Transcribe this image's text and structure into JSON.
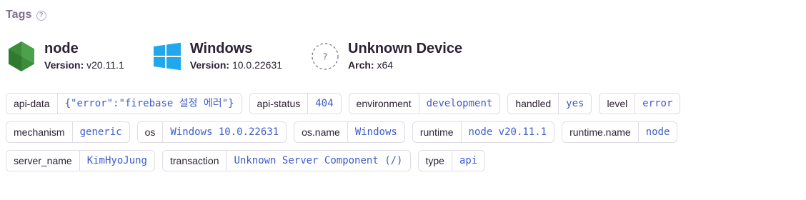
{
  "header": {
    "title": "Tags",
    "help_glyph": "?"
  },
  "contexts": [
    {
      "name": "node",
      "sub_key": "Version:",
      "sub_val": "v20.11.1",
      "icon": "nodejs-icon"
    },
    {
      "name": "Windows",
      "sub_key": "Version:",
      "sub_val": "10.0.22631",
      "icon": "windows-icon"
    },
    {
      "name": "Unknown Device",
      "sub_key": "Arch:",
      "sub_val": "x64",
      "icon": "unknown-device-icon",
      "icon_glyph": "?"
    }
  ],
  "colors": {
    "title": "#80708f",
    "value_link": "#3d5ccc",
    "border": "#e0dce5",
    "node_green": "#3c8c3c",
    "windows_blue": "#1fa8ee"
  },
  "tags": [
    {
      "key": "api-data",
      "value": "{\"error\":\"firebase 설정 에러\"}"
    },
    {
      "key": "api-status",
      "value": "404"
    },
    {
      "key": "environment",
      "value": "development"
    },
    {
      "key": "handled",
      "value": "yes"
    },
    {
      "key": "level",
      "value": "error"
    },
    {
      "key": "mechanism",
      "value": "generic"
    },
    {
      "key": "os",
      "value": "Windows 10.0.22631"
    },
    {
      "key": "os.name",
      "value": "Windows"
    },
    {
      "key": "runtime",
      "value": "node v20.11.1"
    },
    {
      "key": "runtime.name",
      "value": "node"
    },
    {
      "key": "server_name",
      "value": "KimHyoJung"
    },
    {
      "key": "transaction",
      "value": "Unknown Server Component (/)"
    },
    {
      "key": "type",
      "value": "api"
    }
  ]
}
